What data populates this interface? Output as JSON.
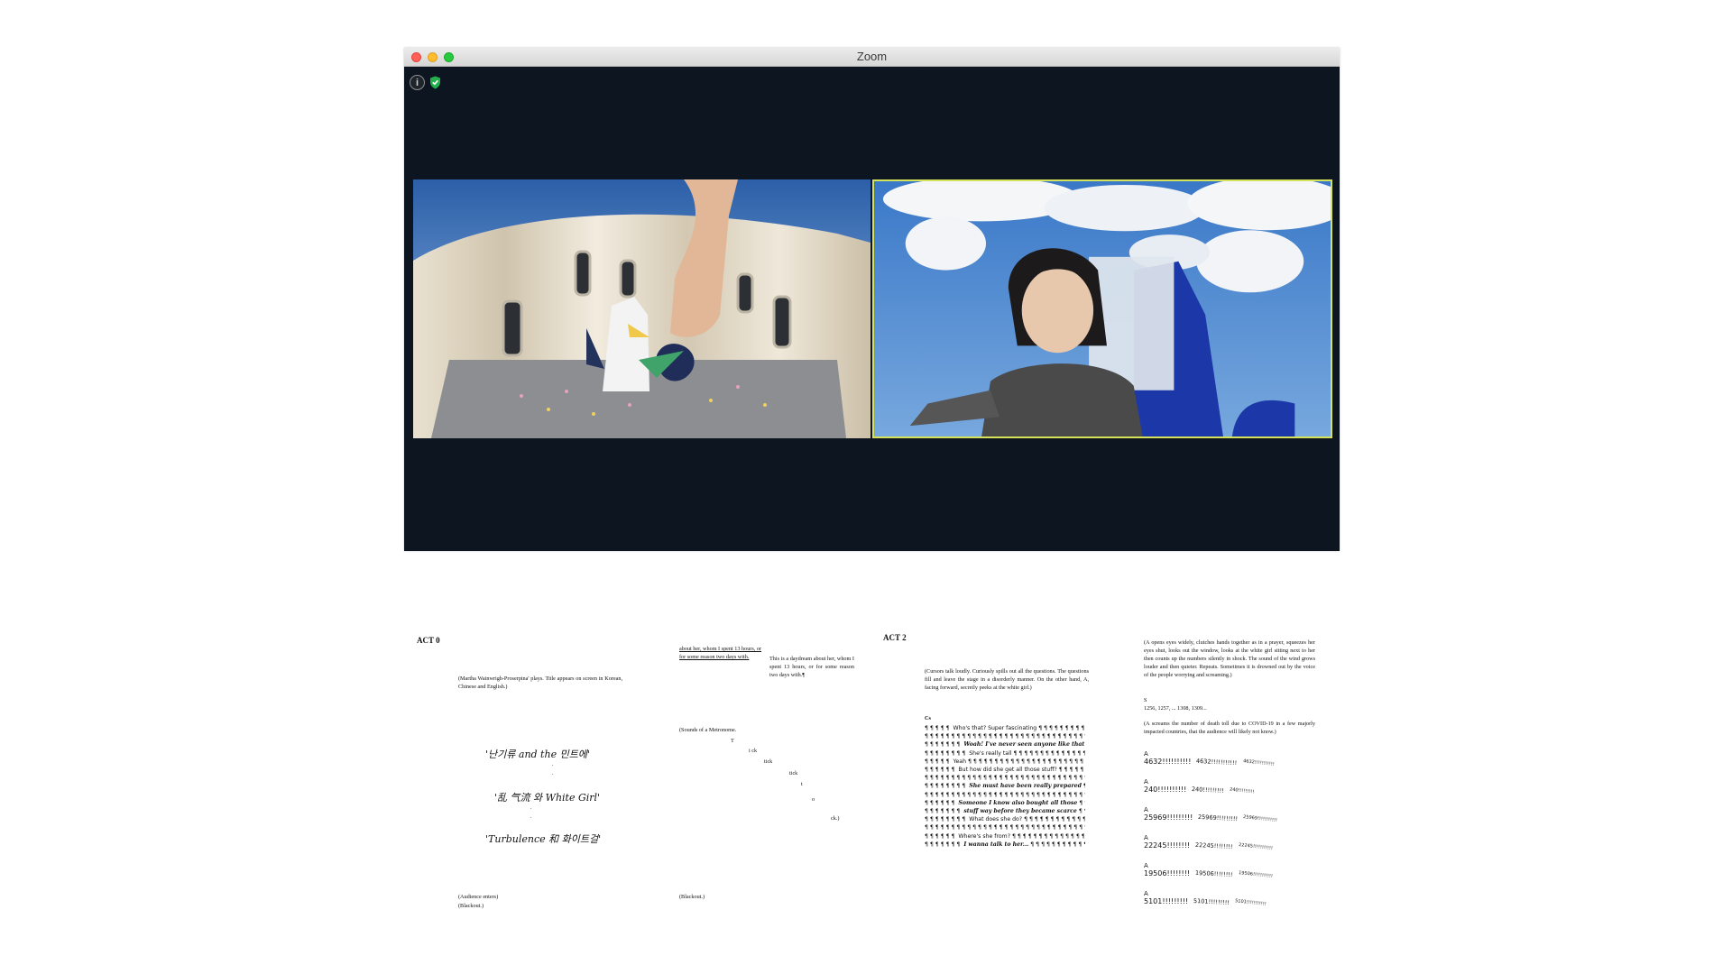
{
  "window": {
    "title": "Zoom",
    "icons": [
      "info-icon",
      "security-shield-icon"
    ],
    "controls": [
      "close",
      "minimize",
      "maximize"
    ]
  },
  "videos": [
    {
      "name": "participant-1",
      "description_icon": "video-feed"
    },
    {
      "name": "participant-2",
      "description_icon": "video-feed",
      "active_speaker": true
    }
  ],
  "script": {
    "page1": {
      "heading": "ACT 0",
      "direction": "(Martha Wainwrigh-Proserpina' plays. Title appears on screen in Korean, Chinese and English.)",
      "titles": [
        "'난기류 and the 민트에'",
        "'乱 气流 와 White Girl'",
        "'Turbulence 和 화이트걸'"
      ],
      "footer1": "(Audience enters)",
      "footer2": "(Blackout.)"
    },
    "page2": {
      "underlined": "about her, whom I spent 13 hours, or for some reason two days with.",
      "daydream": "This is a daydream about her, whom I spent 13 hours, or for some reason two days with.¶",
      "metronome": "(Sounds of a Metronome.",
      "ticks": [
        "T",
        "i ck",
        "tick",
        "tick",
        "t",
        "o",
        "ck.)"
      ],
      "footer": "(Blackout.)"
    },
    "page3": {
      "heading": "ACT 2",
      "direction": "(Cursors talk loudly. Curiously spills out all the questions. The questions fill and leave the stage in a disorderly manner. On the other hand, A, facing forward, secretly peeks at the white girl.)",
      "speaker": "Cs",
      "lines": [
        {
          "text": "Who's that? Super fascinating",
          "italic": false
        },
        {
          "text": "",
          "italic": false
        },
        {
          "text": "Woah! I've never seen anyone like that in person",
          "italic": true
        },
        {
          "text": "She's really tall",
          "italic": false
        },
        {
          "text": "Yeah",
          "italic": false
        },
        {
          "text": "But how did she get all those stuff?",
          "italic": false
        },
        {
          "text": "",
          "italic": false
        },
        {
          "text": "She must have been really prepared",
          "italic": true
        },
        {
          "text": "",
          "italic": false
        },
        {
          "text": "Someone I know also bought all those",
          "italic": true
        },
        {
          "text": "stuff way before they became scarce",
          "italic": true
        },
        {
          "text": "What does she do?",
          "italic": false
        },
        {
          "text": "",
          "italic": false
        },
        {
          "text": "Where's she from?",
          "italic": false
        },
        {
          "text": "I wanna talk to her...",
          "italic": true
        }
      ]
    },
    "page4": {
      "direction": "(A opens eyes widely, clutches hands together as in a prayer, squeezes her eyes shut, looks out the window, looks at the white girl sitting next to her then counts up the numbers silently in shock. The sound of the wind grows louder and then quieter. Repeats. Sometimes it is drowned out by the voice of the people worrying and screaming.)",
      "s_label": "S",
      "s_numbers": "1256, 1257, ... 1308, 1309...",
      "direction2": "(A screams the number of death toll due to COVID-19 in a few majorly impacted countries, that the audience will likely not know.)",
      "counts": [
        {
          "label": "A",
          "values": [
            "4632!!!!!!!!!!",
            "4632!!!!!!!!!!!",
            "4632!!!!!!!!!!!"
          ]
        },
        {
          "label": "A",
          "values": [
            "240!!!!!!!!!!",
            "240!!!!!!!!!",
            "240!!!!!!!!!"
          ]
        },
        {
          "label": "A",
          "values": [
            "25969!!!!!!!!!",
            "25969!!!!!!!!!",
            "25969!!!!!!!!!!!"
          ]
        },
        {
          "label": "A",
          "values": [
            "22245!!!!!!!!",
            "22245!!!!!!!!",
            "22245!!!!!!!!!!!"
          ]
        },
        {
          "label": "A",
          "values": [
            "19506!!!!!!!!",
            "19506!!!!!!!!",
            "19506!!!!!!!!!!!"
          ]
        },
        {
          "label": "A",
          "values": [
            "5101!!!!!!!!!",
            "5101!!!!!!!!!",
            "5101!!!!!!!!!!!"
          ]
        }
      ]
    }
  }
}
